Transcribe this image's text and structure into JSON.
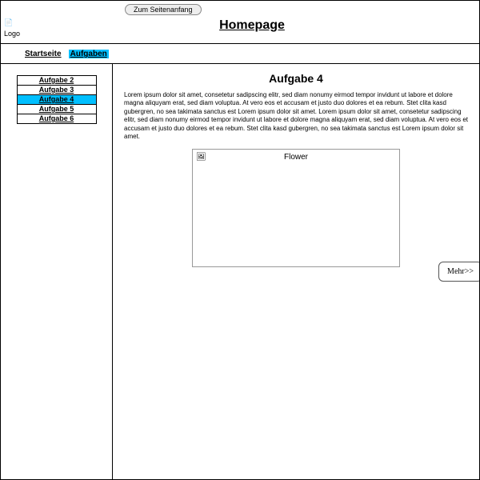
{
  "top_button": "Zum Seitenanfang",
  "logo_alt": "Logo",
  "title": "Homepage",
  "nav": {
    "home": "Startseite",
    "tasks": "Aufgaben"
  },
  "sidebar": {
    "items": [
      "Aufgabe 2",
      "Aufgabe 3",
      "Aufgabe 4",
      "Aufgabe 5",
      "Aufgabe 6"
    ],
    "active_index": 2
  },
  "content": {
    "heading": "Aufgabe 4",
    "paragraph": "Lorem ipsum dolor sit amet, consetetur sadipscing elitr, sed diam nonumy eirmod tempor invidunt ut labore et dolore magna aliquyam erat, sed diam voluptua. At vero eos et accusam et justo duo dolores et ea rebum. Stet clita kasd gubergren, no sea takimata sanctus est Lorem ipsum dolor sit amet. Lorem ipsum dolor sit amet, consetetur sadipscing elitr, sed diam nonumy eirmod tempor invidunt ut labore et dolore magna aliquyam erat, sed diam voluptua. At vero eos et accusam et justo duo dolores et ea rebum. Stet clita kasd gubergren, no sea takimata sanctus est Lorem ipsum dolor sit amet.",
    "image_alt": "Flower",
    "more_label": "Mehr>>"
  }
}
